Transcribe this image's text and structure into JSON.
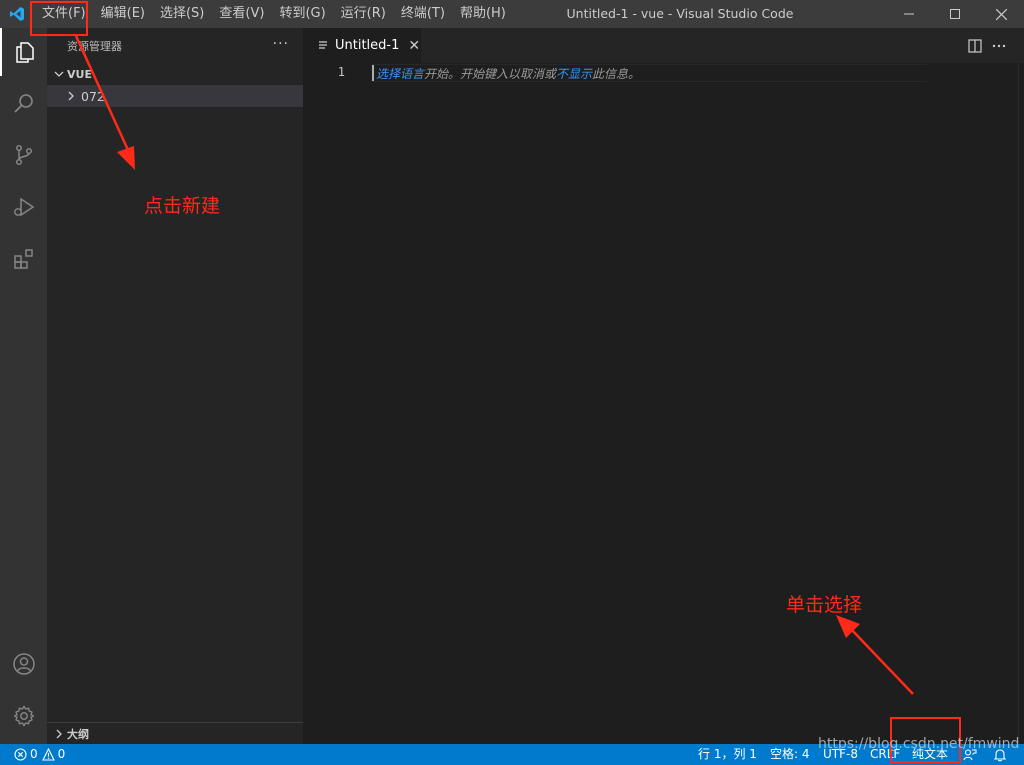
{
  "app": {
    "window_title": "Untitled-1 - vue - Visual Studio Code",
    "logo_icon": "vscode-logo-icon"
  },
  "menu": {
    "items": [
      "文件(F)",
      "编辑(E)",
      "选择(S)",
      "查看(V)",
      "转到(G)",
      "运行(R)",
      "终端(T)",
      "帮助(H)"
    ]
  },
  "window_controls": {
    "icons": [
      "minimize-icon",
      "maximize-icon",
      "close-icon"
    ]
  },
  "activity_bar": {
    "icons": [
      "explorer-icon",
      "search-icon",
      "source-control-icon",
      "run-debug-icon",
      "extensions-icon",
      "account-icon",
      "settings-gear-icon"
    ]
  },
  "sidebar": {
    "title": "资源管理器",
    "more_label": "···",
    "workspace": "VUE",
    "folder": "072",
    "outline": "大纲"
  },
  "editor": {
    "tab_label": "Untitled-1",
    "tab_close": "✕",
    "line_number": "1",
    "hint_link_1": "选择语言",
    "hint_text_1": "开始。开始键入以取消或",
    "hint_link_2": "不显示",
    "hint_text_2": "此信息。"
  },
  "status_bar": {
    "errors": "0",
    "warnings": "0",
    "position": "行 1，列 1",
    "indent": "空格: 4",
    "encoding": "UTF-8",
    "eol": "CRLF",
    "language": "纯文本"
  },
  "annotations": {
    "label_new": "点击新建",
    "label_select": "单击选择",
    "color": "#ff2a1a"
  },
  "watermark": "https://blog.csdn.net/fmwind",
  "colors": {
    "accent": "#007acc",
    "link": "#3794ff",
    "titlebar": "#3c3c3c",
    "activitybar": "#333333",
    "sidebar": "#252526",
    "editor": "#1e1e1e"
  }
}
